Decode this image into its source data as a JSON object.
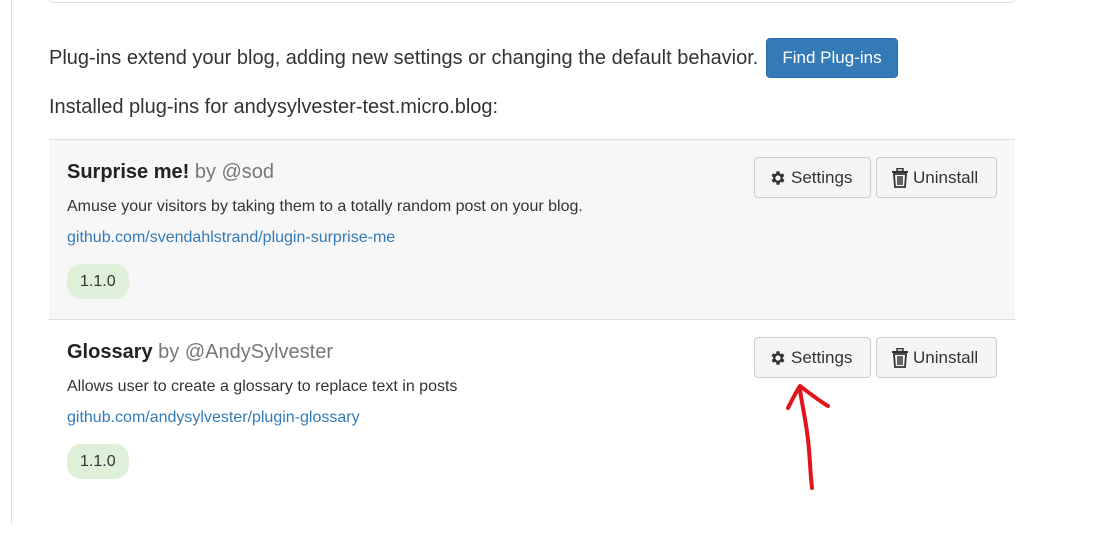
{
  "intro": {
    "text": "Plug-ins extend your blog, adding new settings or changing the default behavior.",
    "find_button": "Find Plug-ins"
  },
  "installed_heading": "Installed plug-ins for andysylvester-test.micro.blog:",
  "plugins": [
    {
      "name": "Surprise me!",
      "by": "by @sod",
      "description": "Amuse your visitors by taking them to a totally random post on your blog.",
      "link": "github.com/svendahlstrand/plugin-surprise-me",
      "version": "1.1.0",
      "settings_label": "Settings",
      "uninstall_label": "Uninstall"
    },
    {
      "name": "Glossary",
      "by": "by @AndySylvester",
      "description": "Allows user to create a glossary to replace text in posts",
      "link": "github.com/andysylvester/plugin-glossary",
      "version": "1.1.0",
      "settings_label": "Settings",
      "uninstall_label": "Uninstall"
    }
  ],
  "colors": {
    "primary": "#337ab7",
    "version_badge": "#dff0d8",
    "annotation_red": "#e0141b",
    "shaded_row": "#f7f7f7"
  },
  "icons": {
    "settings": "gear-icon",
    "uninstall": "trash-icon"
  }
}
